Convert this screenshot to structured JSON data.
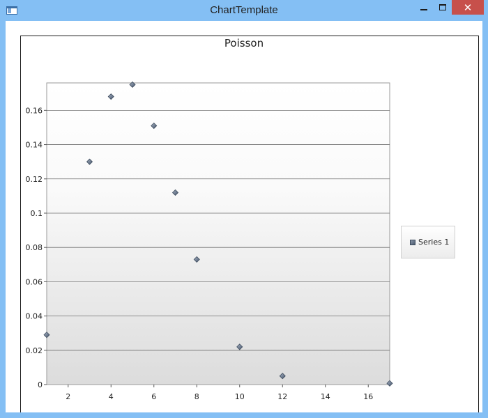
{
  "window": {
    "title": "ChartTemplate",
    "close_glyph": "✕"
  },
  "chart_data": {
    "type": "scatter",
    "title": "Poisson",
    "xlabel": "",
    "ylabel": "",
    "xlim": [
      1,
      17
    ],
    "ylim": [
      0,
      0.176
    ],
    "x_ticks": [
      2,
      4,
      6,
      8,
      10,
      12,
      14,
      16
    ],
    "y_ticks": [
      0,
      0.02,
      0.04,
      0.06,
      0.08,
      0.1,
      0.12,
      0.14,
      0.16
    ],
    "y_tick_labels": [
      "0",
      "0.02",
      "0.04",
      "0.06",
      "0.08",
      "0.1",
      "0.12",
      "0.14",
      "0.16"
    ],
    "grid": "horizontal",
    "legend_position": "right",
    "series": [
      {
        "name": "Series 1",
        "color": "#5a6a80",
        "marker": "diamond",
        "points": [
          {
            "x": 1,
            "y": 0.029
          },
          {
            "x": 3,
            "y": 0.13
          },
          {
            "x": 4,
            "y": 0.168
          },
          {
            "x": 5,
            "y": 0.175
          },
          {
            "x": 6,
            "y": 0.151
          },
          {
            "x": 7,
            "y": 0.112
          },
          {
            "x": 8,
            "y": 0.073
          },
          {
            "x": 10,
            "y": 0.022
          },
          {
            "x": 12,
            "y": 0.005
          },
          {
            "x": 17,
            "y": 0.0007
          }
        ]
      }
    ]
  }
}
